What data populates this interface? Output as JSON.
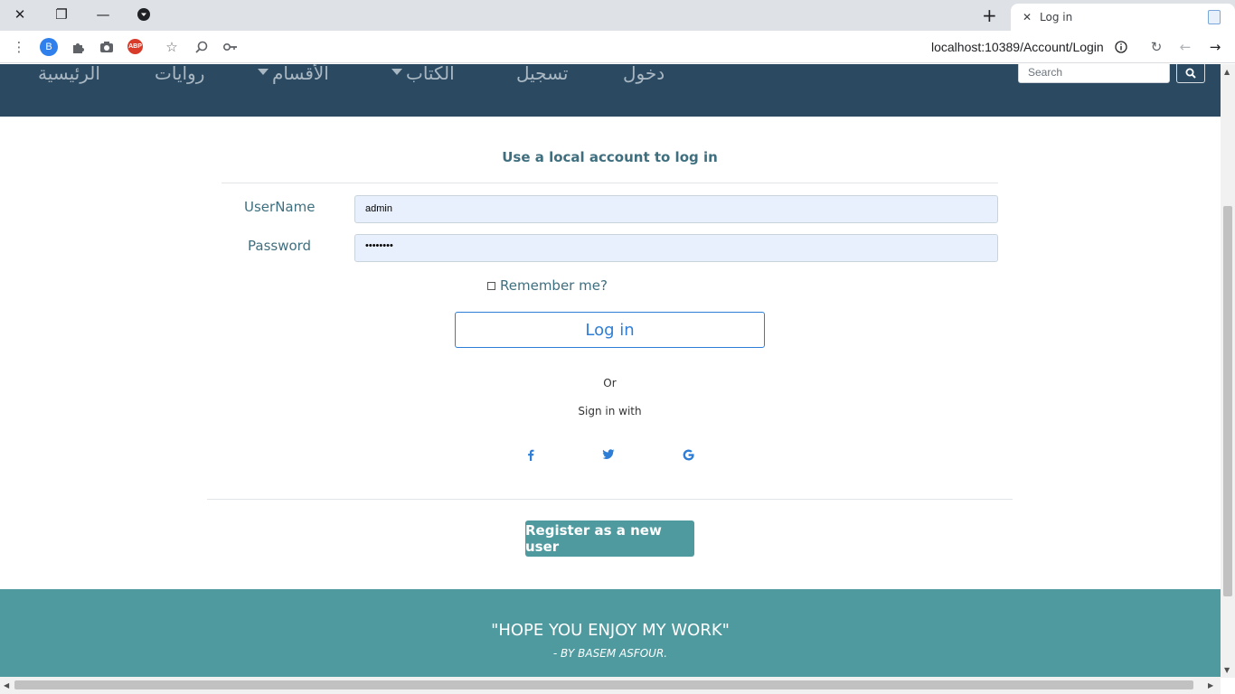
{
  "browser": {
    "tab_title": "Log in",
    "url": "localhost:10389/Account/Login",
    "profile_initial": "B",
    "extension_abp": "ABP"
  },
  "navbar": {
    "items": [
      {
        "label": "الرئيسية"
      },
      {
        "label": "روايات"
      },
      {
        "label": "الأقسام"
      },
      {
        "label": "الكتاب"
      },
      {
        "label": "تسجيل"
      },
      {
        "label": "دخول"
      }
    ],
    "search_placeholder": "Search"
  },
  "login": {
    "heading": "Use a local account to log in",
    "username_label": "UserName",
    "username_value": "admin",
    "password_label": "Password",
    "password_value": "••••••••",
    "remember_label": "Remember me?",
    "remember_checked": false,
    "login_button": "Log in",
    "or_text": "Or",
    "sign_in_with": "Sign in with",
    "social_icons": [
      "facebook-icon",
      "twitter-icon",
      "google-icon"
    ],
    "register_button": "Register as a new user"
  },
  "footer": {
    "quote": "\"HOPE YOU ENJOY MY WORK\"",
    "author": "- BY BASEM ASFOUR."
  },
  "colors": {
    "navbar": "#2b4a62",
    "accent_teal": "#4f9a9f",
    "link_blue": "#2e7dd6",
    "label_text": "#3f6f7f"
  }
}
